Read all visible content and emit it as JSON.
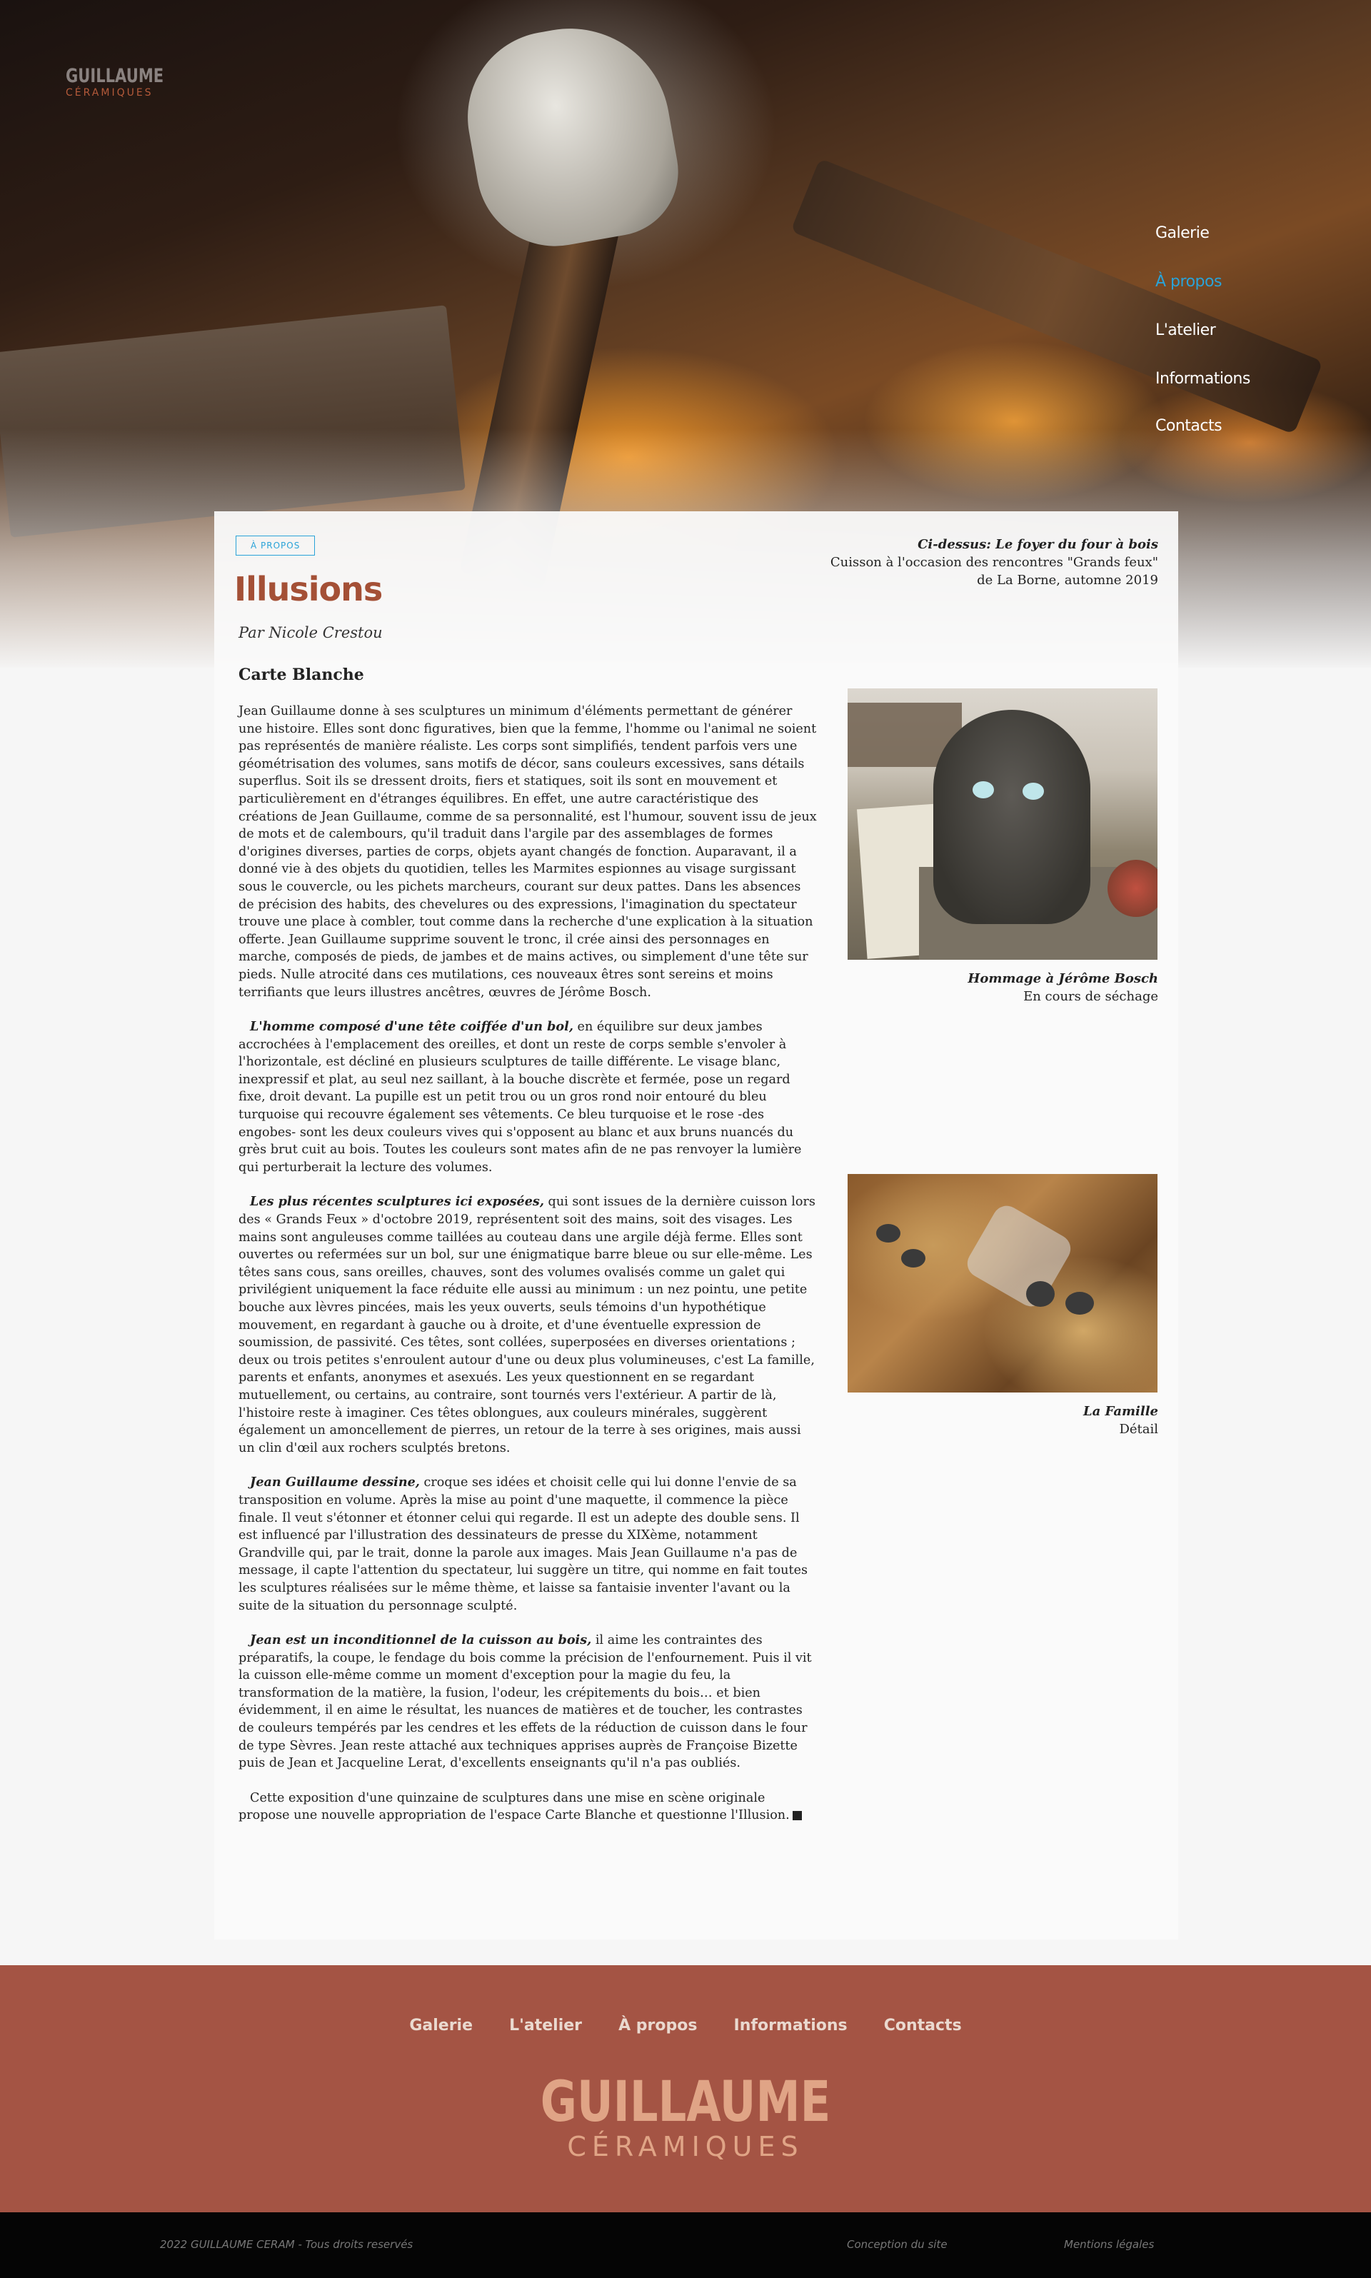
{
  "header": {
    "logo_top": "GUILLAUME",
    "logo_bottom": "CÉRAMIQUES",
    "nav": [
      {
        "label": "Galerie",
        "active": false
      },
      {
        "label": "À propos",
        "active": true
      },
      {
        "label": "L'atelier",
        "active": false
      },
      {
        "label": "Informations",
        "active": false
      },
      {
        "label": "Contacts",
        "active": false
      }
    ]
  },
  "hero_caption": {
    "title": "Ci-dessus: Le foyer du four à bois",
    "line1": "Cuisson à l'occasion des rencontres  \"Grands feux\"",
    "line2": "de La Borne, automne 2019"
  },
  "article": {
    "tag": "À PROPOS",
    "title": "Illusions",
    "byline": "Par Nicole Crestou",
    "section": "Carte Blanche",
    "p1": "Jean Guillaume donne à ses sculptures un minimum d'éléments permettant de générer une histoire. Elles sont donc figuratives, bien que la femme, l'homme ou l'animal ne soient pas représentés de manière réaliste. Les corps sont simplifiés, tendent parfois vers une géométrisation des volumes, sans motifs de décor, sans couleurs excessives, sans détails superflus. Soit ils se dressent droits, fiers et statiques, soit ils sont en mouvement et particulièrement en d'étranges équilibres. En effet, une autre caractéristique des créations de Jean Guillaume, comme de sa personnalité, est l'humour, souvent issu de jeux de mots et de calembours, qu'il traduit dans l'argile par des assemblages de formes d'origines diverses, parties de corps, objets ayant changés de fonction. Auparavant, il a donné vie à des objets du quotidien, telles les Marmites espionnes au visage surgissant sous le couvercle, ou les pichets marcheurs, courant sur deux pattes. Dans les absences de précision des habits, des chevelures ou des expressions, l'imagination du spectateur trouve une place à combler, tout comme dans la recherche d'une explication à la situation offerte. Jean Guillaume supprime souvent le tronc, il crée ainsi des personnages en marche, composés de pieds, de jambes et de mains actives, ou simplement d'une tête sur pieds. Nulle atrocité dans ces mutilations, ces nouveaux êtres sont sereins et moins terrifiants que leurs illustres ancêtres, œuvres de Jérôme Bosch.",
    "p2_lead": "L'homme composé d'une tête coiffée d'un bol,",
    "p2": " en équilibre sur deux jambes accrochées à l'emplacement des oreilles, et dont un reste de corps semble s'envoler à l'horizontale, est décliné en plusieurs sculptures de taille différente. Le visage blanc, inexpressif et plat, au seul nez saillant, à la bouche discrète et fermée, pose un regard fixe, droit devant. La pupille est un petit trou ou un gros rond noir entouré du bleu turquoise qui recouvre également ses vêtements. Ce bleu turquoise et le rose -des engobes- sont les deux couleurs vives qui s'opposent au blanc et aux bruns nuancés du grès brut cuit au bois. Toutes les couleurs sont mates afin de ne pas renvoyer la lumière qui perturberait la lecture des volumes.",
    "p3_lead": "Les plus récentes sculptures ici exposées,",
    "p3": " qui sont issues de la dernière cuisson lors des « Grands Feux » d'octobre 2019, représentent soit des mains, soit des visages. Les mains sont anguleuses comme taillées au couteau dans une argile déjà ferme. Elles sont ouvertes ou refermées sur un bol, sur une énigmatique barre bleue ou sur elle-même. Les têtes sans cous, sans oreilles, chauves, sont des volumes ovalisés comme un galet qui privilégient uniquement la face réduite elle aussi au minimum : un nez pointu, une petite bouche aux lèvres pincées, mais les yeux ouverts, seuls témoins d'un hypothétique mouvement, en regardant à gauche ou à droite, et d'une éventuelle expression de soumission, de passivité. Ces têtes, sont collées, superposées en diverses orientations ; deux ou trois petites s'enroulent autour d'une ou deux plus volumineuses, c'est La famille, parents et enfants, anonymes et asexués. Les yeux questionnent en se regardant mutuellement, ou  certains, au contraire, sont tournés vers l'extérieur. A partir de là, l'histoire reste à imaginer. Ces têtes oblongues, aux couleurs minérales, suggèrent également un amoncellement de pierres, un retour de la terre à ses origines, mais aussi un clin d'œil aux rochers sculptés bretons.",
    "p4_lead": "Jean Guillaume dessine,",
    "p4": " croque ses idées et choisit celle qui lui donne l'envie de sa transposition en volume. Après la mise au point d'une maquette, il commence la pièce finale. Il veut s'étonner et étonner celui qui regarde. Il est un adepte des double sens. Il est influencé par l'illustration des dessinateurs de presse du XIXème, notamment Grandville qui, par le trait, donne la parole aux images. Mais Jean Guillaume n'a pas de message, il capte l'attention du spectateur, lui suggère un titre, qui nomme en fait toutes les sculptures réalisées sur le même thème, et laisse sa fantaisie inventer l'avant ou la suite de la situation du personnage sculpté.",
    "p5_lead": "Jean est un inconditionnel de la cuisson au bois,",
    "p5": " il aime les contraintes des préparatifs, la coupe, le fendage du bois comme la précision de l'enfournement. Puis il vit la cuisson elle-même comme un moment d'exception pour la magie du feu, la transformation de la matière, la fusion, l'odeur, les crépitements du bois… et bien évidemment, il en aime le résultat, les nuances de matières et de toucher, les contrastes de couleurs tempérés par les cendres et les effets de la réduction de cuisson dans le four de type Sèvres. Jean reste attaché aux techniques apprises auprès de Françoise Bizette puis de Jean et Jacqueline Lerat, d'excellents enseignants qu'il n'a pas oubliés.",
    "p6": "Cette exposition d'une quinzaine de sculptures dans une mise en scène originale propose une nouvelle appropriation de l'espace Carte Blanche et questionne l'Illusion."
  },
  "figures": [
    {
      "title": "Hommage à Jérôme Bosch",
      "subtitle": "En cours de séchage"
    },
    {
      "title": "La Famille",
      "subtitle": "Détail"
    }
  ],
  "footer": {
    "nav": [
      "Galerie",
      "L'atelier",
      "À propos",
      "Informations",
      "Contacts"
    ],
    "logo_top": "GUILLAUME",
    "logo_bottom": "CÉRAMIQUES",
    "copyright": "2022  GUILLAUME CERAM - Tous droits reservés",
    "link_credits": "Conception du site",
    "link_legal": "Mentions légales"
  },
  "colors": {
    "accent": "#2aa3d8",
    "brand": "#a45036",
    "footer_bg": "#a45444"
  }
}
